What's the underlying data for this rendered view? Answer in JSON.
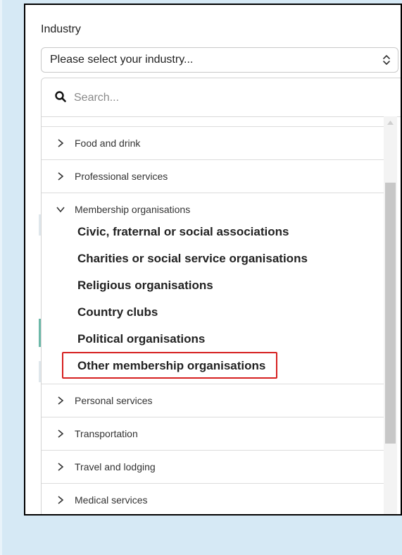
{
  "form": {
    "field_label": "Industry",
    "select_value": "Please select your industry...",
    "search_placeholder": "Search..."
  },
  "categories_top": [
    {
      "label": "Food and drink",
      "expanded": false
    },
    {
      "label": "Professional services",
      "expanded": false
    }
  ],
  "expanded_category": {
    "label": "Membership organisations",
    "items": [
      {
        "label": "Civic, fraternal or social associations",
        "highlighted": false
      },
      {
        "label": "Charities or social service organisations",
        "highlighted": false
      },
      {
        "label": "Religious organisations",
        "highlighted": false
      },
      {
        "label": "Country clubs",
        "highlighted": false
      },
      {
        "label": "Political organisations",
        "highlighted": false
      },
      {
        "label": "Other membership organisations",
        "highlighted": true
      }
    ]
  },
  "categories_bottom": [
    {
      "label": "Personal services",
      "expanded": false
    },
    {
      "label": "Transportation",
      "expanded": false
    },
    {
      "label": "Travel and lodging",
      "expanded": false
    },
    {
      "label": "Medical services",
      "expanded": false
    }
  ],
  "icons": {
    "search": "search-icon",
    "select_caret": "updown-chevron-icon",
    "collapsed": "chevron-right-icon",
    "expanded": "chevron-down-icon"
  },
  "colors": {
    "page_background": "#d6e9f5",
    "highlight_border": "#d62020",
    "scroll_thumb": "#c7c7c7"
  }
}
